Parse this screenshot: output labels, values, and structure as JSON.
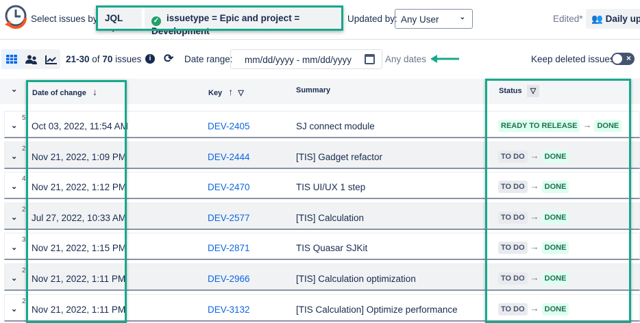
{
  "header": {
    "select_label": "Select issues by:",
    "mode": "JQL",
    "query": "issuetype = Epic and project = Development",
    "updated_label": "Updated by:",
    "updated_value": "Any User",
    "edited": "Edited*",
    "view_name": "Daily updates"
  },
  "toolbar": {
    "count_range": "21-30",
    "count_of": "of",
    "count_total": "70",
    "count_suffix": "issues",
    "date_label": "Date range:",
    "date_placeholder": "mm/dd/yyyy - mm/dd/yyyy",
    "any_dates": "Any dates",
    "keep_deleted": "Keep deleted issues",
    "keep_deleted_on": false
  },
  "columns": {
    "date": "Date of change",
    "key": "Key",
    "summary": "Summary",
    "status": "Status"
  },
  "rows": [
    {
      "count": "5",
      "date": "Oct 03, 2022, 11:54 AM",
      "key": "DEV-2405",
      "summary": "SJ connect module",
      "from": "READY TO RELEASE",
      "to": "DONE",
      "from_color": "green"
    },
    {
      "count": "2",
      "date": "Nov 21, 2022, 1:09 PM",
      "key": "DEV-2444",
      "summary": "[TIS] Gadget refactor",
      "from": "TO DO",
      "to": "DONE",
      "from_color": "gray"
    },
    {
      "count": "4",
      "date": "Nov 21, 2022, 1:12 PM",
      "key": "DEV-2470",
      "summary": "TIS UI/UX 1 step",
      "from": "TO DO",
      "to": "DONE",
      "from_color": "gray"
    },
    {
      "count": "2",
      "date": "Jul 27, 2022, 10:33 AM",
      "key": "DEV-2577",
      "summary": "[TIS] Calculation",
      "from": "TO DO",
      "to": "DONE",
      "from_color": "gray"
    },
    {
      "count": "3",
      "date": "Nov 21, 2022, 1:15 PM",
      "key": "DEV-2871",
      "summary": "TIS Quasar SJKit",
      "from": "TO DO",
      "to": "DONE",
      "from_color": "gray"
    },
    {
      "count": "2",
      "date": "Nov 21, 2022, 1:11 PM",
      "key": "DEV-2966",
      "summary": "[TIS] Calculation optimization",
      "from": "TO DO",
      "to": "DONE",
      "from_color": "gray"
    },
    {
      "count": "2",
      "date": "Nov 21, 2022, 1:11 PM",
      "key": "DEV-3132",
      "summary": "[TIS Calculation] Optimize performance",
      "from": "TO DO",
      "to": "DONE",
      "from_color": "gray"
    }
  ],
  "colors": {
    "highlight": "#14a98b",
    "link": "#0c66e4",
    "done_bg": "#dcfff1"
  }
}
